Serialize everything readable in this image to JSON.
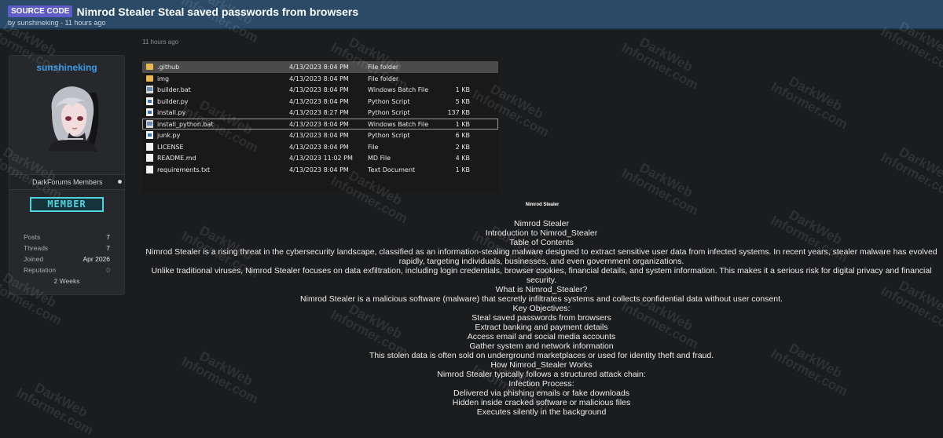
{
  "header": {
    "prefix": "SOURCE CODE",
    "title": "Nimrod Stealer Steal saved passwords from browsers",
    "byline": "by sunshineking - 11 hours ago"
  },
  "post": {
    "time": "11 hours ago",
    "caption": "Nimrod Stealer",
    "lines": [
      "Nimrod Stealer",
      "Introduction to Nimrod_Stealer",
      "Table of Contents",
      "Nimrod Stealer is a rising threat in the cybersecurity landscape, classified as an information-stealing malware designed to extract sensitive user data from infected systems. In recent years, stealer malware has evolved rapidly, targeting individuals, businesses, and even government organizations.",
      "Unlike traditional viruses, Nimrod Stealer focuses on data exfiltration, including login credentials, browser cookies, financial details, and system information. This makes it a serious risk for digital privacy and financial security.",
      "What is Nimrod_Stealer?",
      "Nimrod Stealer is a malicious software (malware) that secretly infiltrates systems and collects confidential data without user consent.",
      "Key Objectives:",
      "Steal saved passwords from browsers",
      "Extract banking and payment details",
      "Access email and social media accounts",
      "Gather system and network information",
      "This stolen data is often sold on underground marketplaces or used for identity theft and fraud.",
      "How Nimrod_Stealer Works",
      "Nimrod Stealer typically follows a structured attack chain:",
      "Infection Process:",
      "Delivered via phishing emails or fake downloads",
      "Hidden inside cracked software or malicious files",
      "Executes silently in the background"
    ]
  },
  "user": {
    "name": "sunshineking",
    "group": "DarkForums Members",
    "rank": "MEMBER",
    "stats": [
      {
        "label": "Posts",
        "value": "7"
      },
      {
        "label": "Threads",
        "value": "7"
      },
      {
        "label": "Joined",
        "value": "Apr 2026"
      },
      {
        "label": "Reputation",
        "value": "0"
      }
    ],
    "duration": "2 Weeks"
  },
  "files": [
    {
      "name": ".github",
      "date": "4/13/2023 8:04 PM",
      "type": "File folder",
      "size": "",
      "icon": "folder-icon"
    },
    {
      "name": "img",
      "date": "4/13/2023 8:04 PM",
      "type": "File folder",
      "size": "",
      "icon": "folder-icon"
    },
    {
      "name": "builder.bat",
      "date": "4/13/2023 8:04 PM",
      "type": "Windows Batch File",
      "size": "1 KB",
      "icon": "batch-file-icon"
    },
    {
      "name": "builder.py",
      "date": "4/13/2023 8:04 PM",
      "type": "Python Script",
      "size": "5 KB",
      "icon": "python-file-icon"
    },
    {
      "name": "install.py",
      "date": "4/13/2023 8:27 PM",
      "type": "Python Script",
      "size": "137 KB",
      "icon": "python-file-icon"
    },
    {
      "name": "install_python.bat",
      "date": "4/13/2023 8:04 PM",
      "type": "Windows Batch File",
      "size": "1 KB",
      "icon": "batch-file-icon"
    },
    {
      "name": "junk.py",
      "date": "4/13/2023 8:04 PM",
      "type": "Python Script",
      "size": "6 KB",
      "icon": "python-file-icon"
    },
    {
      "name": "LICENSE",
      "date": "4/13/2023 8:04 PM",
      "type": "File",
      "size": "2 KB",
      "icon": "file-icon"
    },
    {
      "name": "README.md",
      "date": "4/13/2023 11:02 PM",
      "type": "MD File",
      "size": "4 KB",
      "icon": "file-icon"
    },
    {
      "name": "requirements.txt",
      "date": "4/13/2023 8:04 PM",
      "type": "Text Document",
      "size": "1 KB",
      "icon": "file-icon"
    }
  ],
  "watermark": {
    "line1": "DarkWeb",
    "line2": "Informer.com"
  },
  "colors": {
    "header": "#2b4a68",
    "prefix": "#5d5cc9",
    "username": "#3b9be8",
    "rank": "#4fd3e0"
  }
}
